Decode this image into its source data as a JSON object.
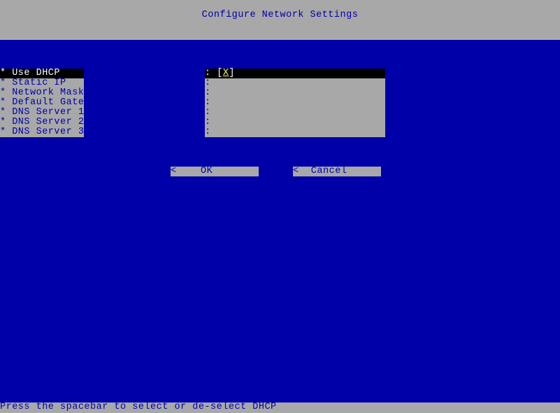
{
  "header": {
    "title": "Configure Network Settings"
  },
  "fields": {
    "items": [
      {
        "label": "* Use DHCP",
        "value": "[X]",
        "selected": true
      },
      {
        "label": "* Static IP",
        "value": "",
        "selected": false
      },
      {
        "label": "* Network Mask",
        "value": "",
        "selected": false
      },
      {
        "label": "* Default Gateway",
        "value": "",
        "selected": false
      },
      {
        "label": "* DNS Server 1",
        "value": "",
        "selected": false
      },
      {
        "label": "* DNS Server 2",
        "value": "",
        "selected": false
      },
      {
        "label": "* DNS Server 3",
        "value": "",
        "selected": false
      }
    ]
  },
  "buttons": {
    "ok": "<    OK          >",
    "cancel": "<  Cancel        >"
  },
  "footer": {
    "hint": "Press the spacebar to select or de-select DHCP"
  }
}
